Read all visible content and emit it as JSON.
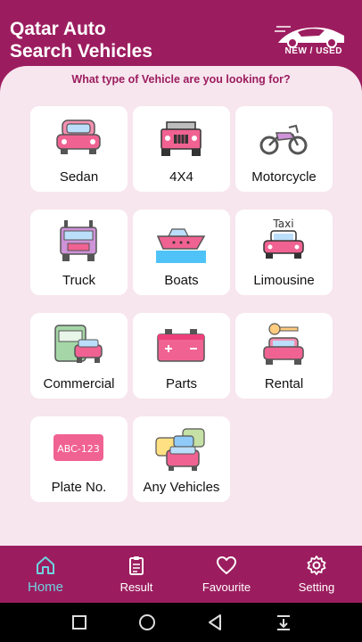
{
  "header": {
    "title_line1": "Qatar Auto",
    "title_line2": "Search Vehicles",
    "logo_text": "NEW / USED"
  },
  "prompt": "What type of Vehicle are you looking for?",
  "categories": [
    {
      "label": "Sedan",
      "icon": "sedan-icon"
    },
    {
      "label": "4X4",
      "icon": "jeep-icon"
    },
    {
      "label": "Motorcycle",
      "icon": "motorcycle-icon"
    },
    {
      "label": "Truck",
      "icon": "truck-icon"
    },
    {
      "label": "Boats",
      "icon": "boat-icon"
    },
    {
      "label": "Limousine",
      "icon": "taxi-icon",
      "icon_text": "Taxi"
    },
    {
      "label": "Commercial",
      "icon": "bus-icon"
    },
    {
      "label": "Parts",
      "icon": "battery-icon"
    },
    {
      "label": "Rental",
      "icon": "car-key-icon"
    },
    {
      "label": "Plate No.",
      "icon": "license-plate-icon",
      "icon_text": "ABC-123"
    },
    {
      "label": "Any Vehicles",
      "icon": "traffic-cars-icon"
    }
  ],
  "bottom_nav": [
    {
      "label": "Home",
      "icon": "home-icon",
      "active": true
    },
    {
      "label": "Result",
      "icon": "clipboard-icon",
      "active": false
    },
    {
      "label": "Favourite",
      "icon": "heart-icon",
      "active": false
    },
    {
      "label": "Setting",
      "icon": "gear-icon",
      "active": false
    }
  ],
  "colors": {
    "primary": "#9c1d5f",
    "background": "#f7e6ee",
    "active_nav": "#6fd3e0",
    "icon_pink": "#f06292"
  }
}
